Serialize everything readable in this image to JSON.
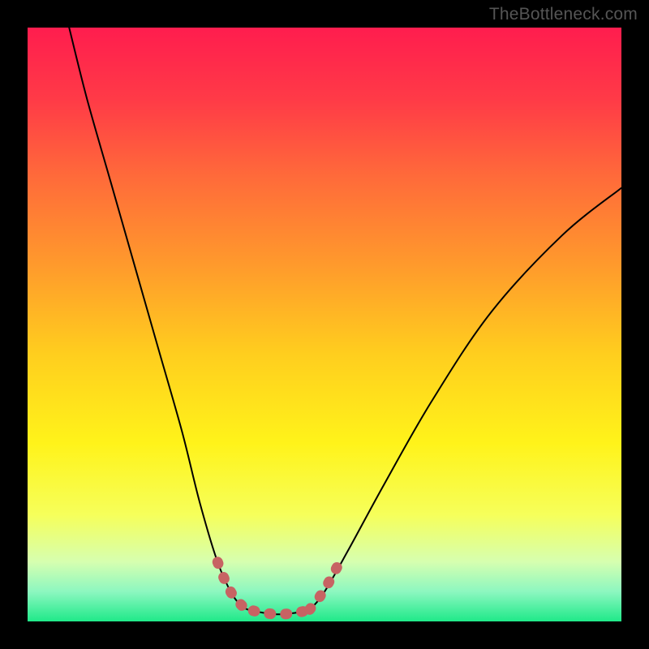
{
  "watermark": {
    "text": "TheBottleneck.com"
  },
  "gradient": {
    "stops": [
      {
        "offset": 0.0,
        "color": "#ff1d4e"
      },
      {
        "offset": 0.12,
        "color": "#ff3a47"
      },
      {
        "offset": 0.25,
        "color": "#ff6a3a"
      },
      {
        "offset": 0.4,
        "color": "#ff9a2c"
      },
      {
        "offset": 0.55,
        "color": "#ffce1e"
      },
      {
        "offset": 0.7,
        "color": "#fff31a"
      },
      {
        "offset": 0.82,
        "color": "#f6ff5a"
      },
      {
        "offset": 0.9,
        "color": "#d6ffb0"
      },
      {
        "offset": 0.95,
        "color": "#8cf7c0"
      },
      {
        "offset": 1.0,
        "color": "#1fe989"
      }
    ]
  },
  "chart_data": {
    "type": "line",
    "title": "",
    "xlabel": "",
    "ylabel": "",
    "xlim": [
      0,
      100
    ],
    "ylim": [
      0,
      100
    ],
    "series": [
      {
        "name": "left-valley-curve",
        "x": [
          7,
          10,
          14,
          18,
          22,
          26,
          29,
          32,
          34.5,
          36.5,
          38
        ],
        "values": [
          100,
          88,
          74,
          60,
          46,
          32,
          20,
          10,
          4.5,
          2.3,
          1.8
        ]
      },
      {
        "name": "valley-floor",
        "x": [
          38,
          40,
          42,
          44,
          46,
          47.5
        ],
        "values": [
          1.8,
          1.4,
          1.2,
          1.3,
          1.6,
          2.0
        ]
      },
      {
        "name": "right-rise-curve",
        "x": [
          47.5,
          50,
          54,
          60,
          68,
          78,
          90,
          100
        ],
        "values": [
          2.0,
          5,
          12,
          23,
          37,
          52,
          65,
          73
        ]
      }
    ],
    "highlight_segments": [
      {
        "name": "left-descent-highlight",
        "x": [
          32,
          33.2,
          34.5,
          35.6,
          36.5,
          37.2,
          38
        ],
        "values": [
          10,
          7,
          4.5,
          3.2,
          2.3,
          2.0,
          1.8
        ]
      },
      {
        "name": "valley-floor-highlight",
        "x": [
          38,
          39,
          40,
          41,
          42,
          43,
          44,
          45,
          46,
          47,
          47.5
        ],
        "values": [
          1.8,
          1.55,
          1.4,
          1.28,
          1.2,
          1.22,
          1.3,
          1.42,
          1.6,
          1.85,
          2.0
        ]
      },
      {
        "name": "right-ascent-highlight",
        "x": [
          47.5,
          48.3,
          49.1,
          49.6,
          50.5,
          51.5,
          53
        ],
        "values": [
          2.0,
          3.0,
          4.0,
          4.8,
          6.2,
          8.0,
          10.8
        ]
      }
    ],
    "colors": {
      "curve": "#000000",
      "highlight": "#c76363"
    }
  }
}
